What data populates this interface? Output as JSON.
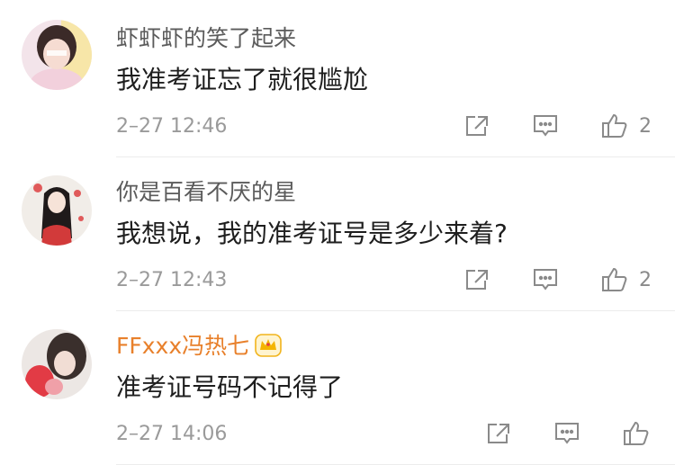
{
  "comments": [
    {
      "username": "虾虾虾的笑了起来",
      "text": "我准考证忘了就很尴尬",
      "time": "2–27 12:46",
      "likes": "2"
    },
    {
      "username": "你是百看不厌的星",
      "text": "我想说，我的准考证号是多少来着?",
      "time": "2–27 12:43",
      "likes": "2"
    },
    {
      "username": "FFxxx冯热七",
      "text": "准考证号码不记得了",
      "time": "2–27 14:06",
      "likes": "",
      "vip": true,
      "badge_icon": "crown-icon"
    }
  ],
  "icons": [
    "share-icon",
    "comment-icon",
    "like-icon"
  ],
  "colors": {
    "vip_name": "#e8802b",
    "name": "#5b5b5b",
    "time": "#9a9a9a"
  }
}
